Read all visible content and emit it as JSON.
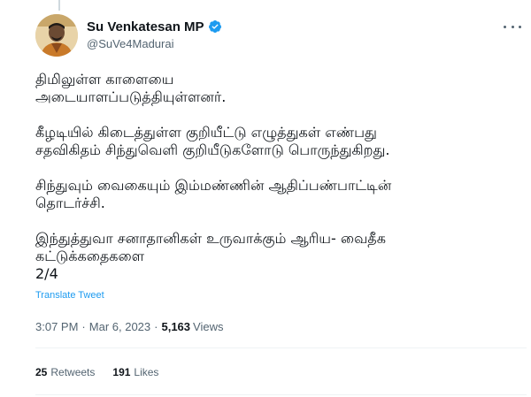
{
  "author": {
    "display_name": "Su Venkatesan MP",
    "handle": "@SuVe4Madurai",
    "verified_icon": "verified-badge-icon",
    "accent_color": "#1d9bf0"
  },
  "tweet": {
    "paragraphs": [
      "திமிலுள்ள காளையை\nஅடையாளப்படுத்தியுள்ளனர்.",
      "கீழடியில் கிடைத்துள்ள குறியீட்டு எழுத்துகள் எண்பது\nசதவிகிதம் சிந்துவெளி குறியீடுகளோடு பொருந்துகிறது.",
      "சிந்துவும் வைகையும் இம்மண்ணின் ஆதிப்பண்பாட்டின்\nதொடர்ச்சி.",
      "இந்துத்துவா சனாதானிகள் உருவாக்கும் ஆரிய- வைதீக\nகட்டுக்கதைகளை\n2/4"
    ],
    "translate_label": "Translate Tweet"
  },
  "meta": {
    "time": "3:07 PM",
    "separator": "·",
    "date": "Mar 6, 2023",
    "views_count": "5,163",
    "views_label": "Views"
  },
  "stats": {
    "retweets_count": "25",
    "retweets_label": "Retweets",
    "likes_count": "191",
    "likes_label": "Likes"
  }
}
